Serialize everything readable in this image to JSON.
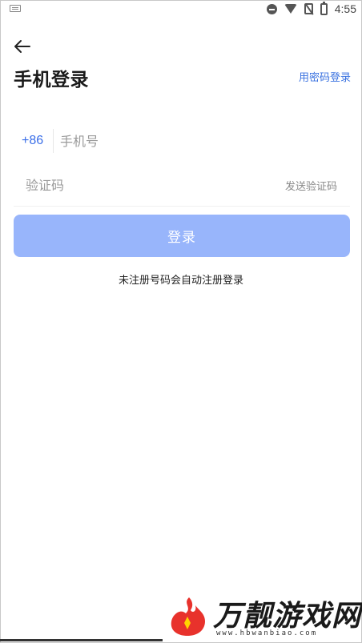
{
  "status_bar": {
    "time": "4:55",
    "icons": [
      "keyboard-icon",
      "do-not-disturb-icon",
      "wifi-icon",
      "no-sim-icon",
      "battery-charging-icon"
    ]
  },
  "header": {
    "back_icon": "arrow-left-icon",
    "title": "手机登录",
    "password_login": "用密码登录"
  },
  "phone": {
    "country_code": "+86",
    "value": "",
    "placeholder": "手机号"
  },
  "code": {
    "value": "",
    "placeholder": "验证码",
    "send_label": "发送验证码"
  },
  "login_button": {
    "label": "登录",
    "color": "#98b5fb"
  },
  "hint": "未注册号码会自动注册登录",
  "watermark": {
    "text": "万靓游戏网",
    "url": "www.hbwanbiao.com"
  },
  "colors": {
    "accent": "#3a72e0",
    "button_disabled": "#98b5fb"
  }
}
